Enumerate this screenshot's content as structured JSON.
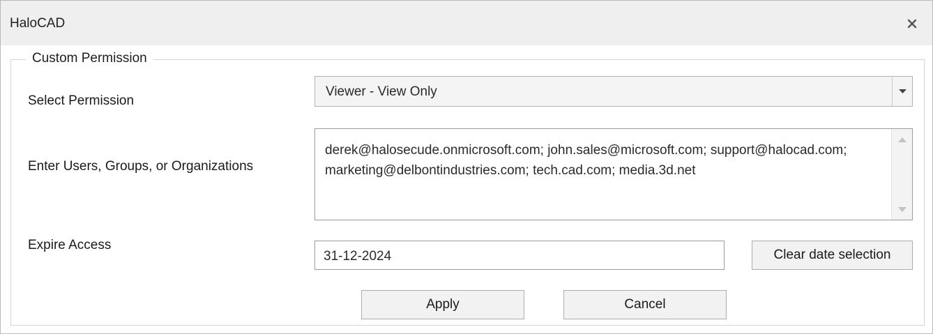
{
  "window": {
    "title": "HaloCAD",
    "close_icon": "close-icon"
  },
  "group": {
    "legend": "Custom Permission"
  },
  "permission": {
    "label": "Select Permission",
    "selected": "Viewer - View Only",
    "arrow_icon": "chevron-down-icon"
  },
  "users": {
    "label": "Enter Users, Groups, or Organizations",
    "value": "derek@halosecude.onmicrosoft.com; john.sales@microsoft.com; support@halocad.com; marketing@delbontindustries.com; tech.cad.com; media.3d.net"
  },
  "expire": {
    "label": "Expire Access",
    "date": "31-12-2024",
    "clear_label": "Clear date selection"
  },
  "actions": {
    "apply_label": "Apply",
    "cancel_label": "Cancel"
  },
  "colors": {
    "titlebar_bg": "#efefef",
    "border": "#b9b9b9",
    "button_bg": "#f2f2f2",
    "combo_bg": "#f4f4f4"
  }
}
